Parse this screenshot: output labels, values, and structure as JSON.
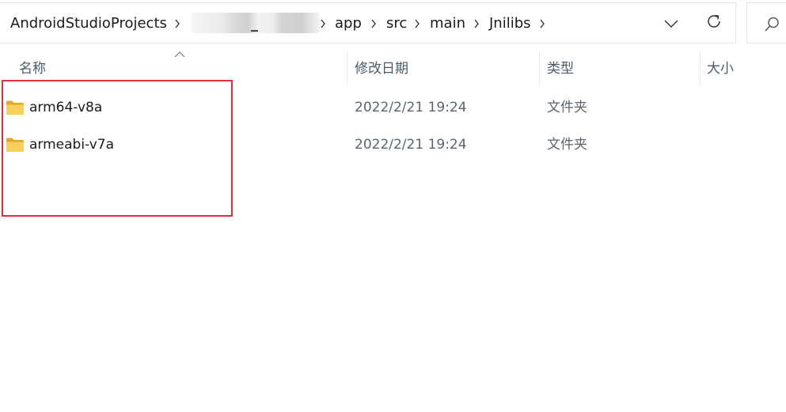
{
  "address_bar": {
    "breadcrumbs": [
      "AndroidStudioProjects",
      "app",
      "src",
      "main",
      "Jnilibs"
    ],
    "redacted_segment": "redacted path segment"
  },
  "toolbar": {
    "dropdown_icon": "chevron-down-icon",
    "refresh_icon": "refresh-icon",
    "search_icon": "search-icon"
  },
  "columns": {
    "name": "名称",
    "modified": "修改日期",
    "type": "类型",
    "size": "大小"
  },
  "files": [
    {
      "name": "arm64-v8a",
      "modified": "2022/2/21 19:24",
      "type": "文件夹",
      "icon": "folder-icon"
    },
    {
      "name": "armeabi-v7a",
      "modified": "2022/2/21 19:24",
      "type": "文件夹",
      "icon": "folder-icon"
    }
  ],
  "colors": {
    "highlight": "#e0303b",
    "folder": "#f5c84c",
    "header_text": "#4a5a6d"
  }
}
